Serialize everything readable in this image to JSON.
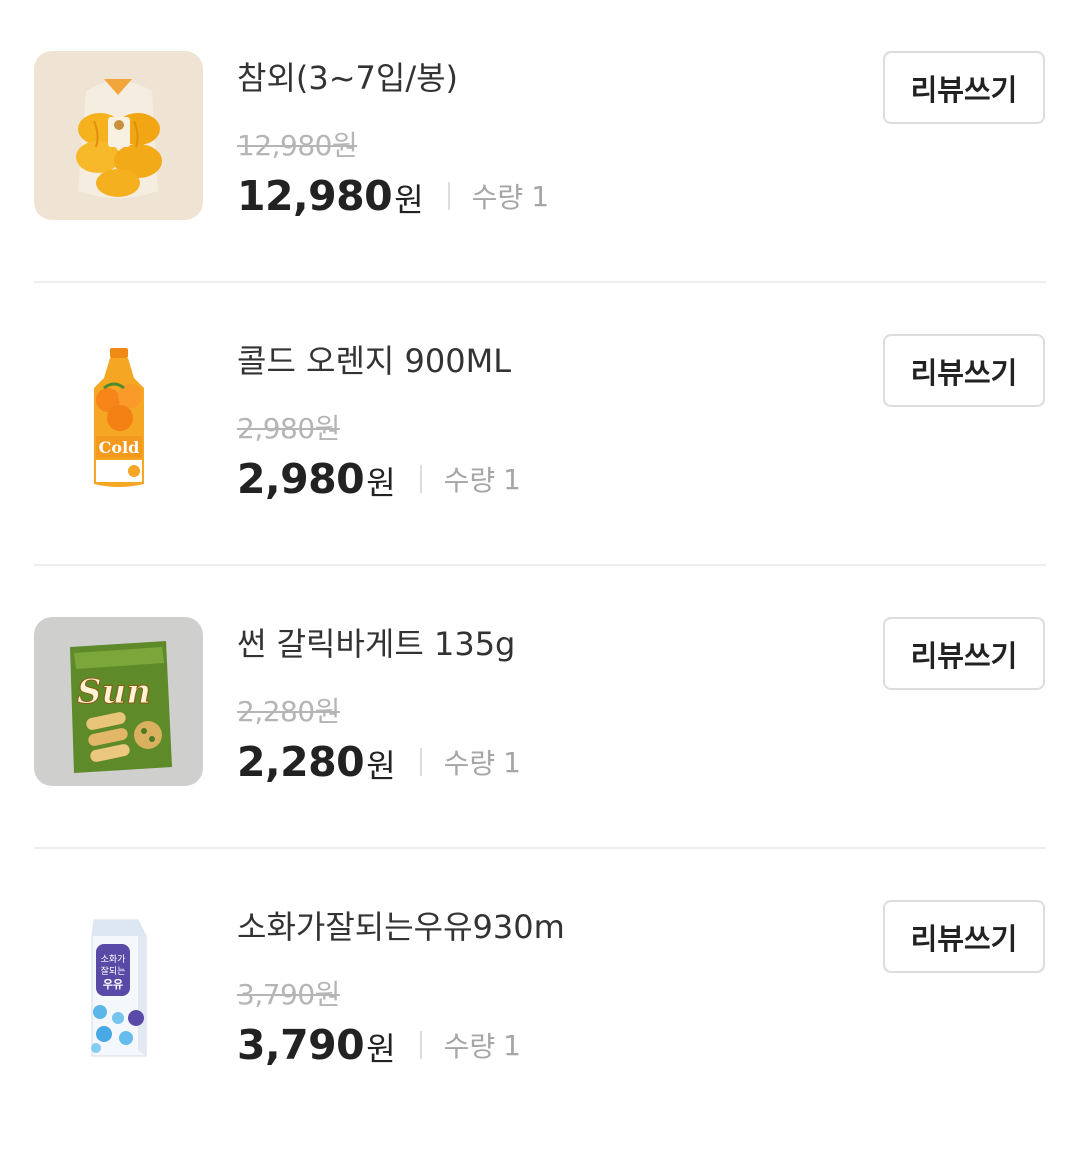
{
  "orders": [
    {
      "title": "참외(3~7입/봉)",
      "original_price": "12,980원",
      "price": "12,980",
      "currency": "원",
      "qty_label": "수량",
      "qty": "1",
      "review_label": "리뷰쓰기",
      "image": "yellow-melon-bag"
    },
    {
      "title": "콜드 오렌지 900ML",
      "original_price": "2,980원",
      "price": "2,980",
      "currency": "원",
      "qty_label": "수량",
      "qty": "1",
      "review_label": "리뷰쓰기",
      "image": "orange-juice-bottle"
    },
    {
      "title": "썬 갈릭바게트 135g",
      "original_price": "2,280원",
      "price": "2,280",
      "currency": "원",
      "qty_label": "수량",
      "qty": "1",
      "review_label": "리뷰쓰기",
      "image": "sun-chips-bag"
    },
    {
      "title": "소화가잘되는우유930m",
      "original_price": "3,790원",
      "price": "3,790",
      "currency": "원",
      "qty_label": "수량",
      "qty": "1",
      "review_label": "리뷰쓰기",
      "image": "milk-carton"
    }
  ],
  "colors": {
    "text": "#222222",
    "muted": "#a6a6a6",
    "strike": "#b5b5b5",
    "divider": "#eeeeee",
    "button_border": "#dddddd"
  }
}
